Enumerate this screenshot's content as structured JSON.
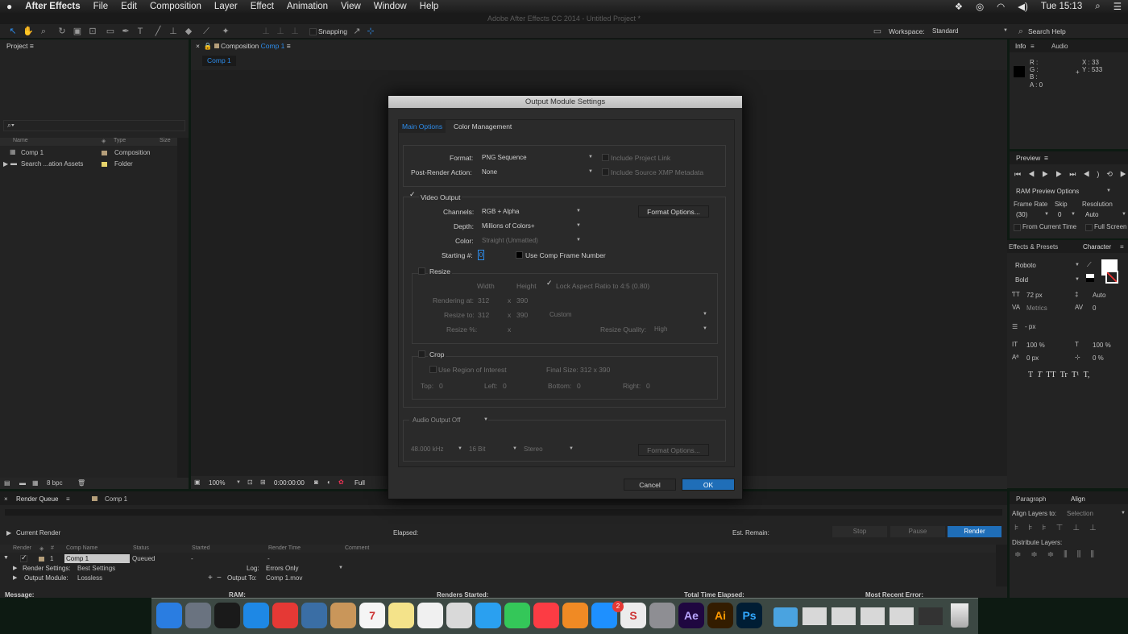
{
  "menubar": {
    "app": "After Effects",
    "items": [
      "File",
      "Edit",
      "Composition",
      "Layer",
      "Effect",
      "Animation",
      "View",
      "Window",
      "Help"
    ],
    "clock": "Tue 15:13"
  },
  "window_title": "Adobe After Effects CC 2014 - Untitled Project *",
  "toolbar": {
    "snapping": "Snapping",
    "workspace_label": "Workspace:",
    "workspace_value": "Standard",
    "search_placeholder": "Search Help"
  },
  "project": {
    "title": "Project",
    "search_icon": "search-icon",
    "columns": [
      "Name",
      "Type",
      "Size"
    ],
    "rows": [
      {
        "name": "Comp 1",
        "type": "Composition"
      },
      {
        "name": "Search ...ation Assets",
        "type": "Folder"
      }
    ],
    "bpc": "8 bpc"
  },
  "composition": {
    "tab_prefix": "Composition",
    "tab_name": "Comp 1",
    "subtab": "Comp 1",
    "zoom": "100%",
    "timecode": "0:00:00:00",
    "resolution": "Full"
  },
  "info": {
    "tabs": [
      "Info",
      "Audio"
    ],
    "r": "R :",
    "g": "G :",
    "b": "B :",
    "a": "A : 0",
    "x": "X : 33",
    "y": "Y : 533"
  },
  "preview": {
    "title": "Preview",
    "ram": "RAM Preview Options",
    "frame_rate_label": "Frame Rate",
    "skip_label": "Skip",
    "resolution_label": "Resolution",
    "frame_rate": "(30)",
    "skip": "0",
    "resolution": "Auto",
    "from_current": "From Current Time",
    "full_screen": "Full Screen"
  },
  "character": {
    "tabs": [
      "Effects & Presets",
      "Character"
    ],
    "font": "Roboto",
    "style": "Bold",
    "size": "72 px",
    "leading": "Auto",
    "kerning": "Metrics",
    "tracking": "0",
    "stroke": "- px",
    "vscale": "100 %",
    "hscale": "100 %",
    "baseline": "0 px",
    "tsume": "0 %",
    "styles": [
      "T",
      "T",
      "TT",
      "Tr",
      "T¹",
      "T,"
    ]
  },
  "align": {
    "tabs": [
      "Paragraph",
      "Align"
    ],
    "align_to": "Align Layers to:",
    "align_to_value": "Selection",
    "distribute": "Distribute Layers:"
  },
  "renderqueue": {
    "tab": "Render Queue",
    "comp_tab": "Comp 1",
    "current_render": "Current Render",
    "elapsed": "Elapsed:",
    "est_remain": "Est. Remain:",
    "stop": "Stop",
    "pause": "Pause",
    "render": "Render",
    "columns": [
      "Render",
      "#",
      "Comp Name",
      "Status",
      "Started",
      "Render Time",
      "Comment"
    ],
    "row": {
      "num": "1",
      "comp": "Comp 1",
      "status": "Queued",
      "started": "-",
      "time": "-"
    },
    "render_settings_label": "Render Settings:",
    "render_settings": "Best Settings",
    "log_label": "Log:",
    "log": "Errors Only",
    "output_module_label": "Output Module:",
    "output_module": "Lossless",
    "output_to_label": "Output To:",
    "output_to": "Comp 1.mov",
    "message": "Message:",
    "ram": "RAM:",
    "renders_started": "Renders Started:",
    "total_elapsed": "Total Time Elapsed:",
    "recent_error": "Most Recent Error:"
  },
  "dialog": {
    "title": "Output Module Settings",
    "tabs": [
      "Main Options",
      "Color Management"
    ],
    "format_label": "Format:",
    "format": "PNG Sequence",
    "include_project_link": "Include Project Link",
    "post_render_label": "Post-Render Action:",
    "post_render": "None",
    "include_xmp": "Include Source XMP Metadata",
    "video_output": "Video Output",
    "channels_label": "Channels:",
    "channels": "RGB + Alpha",
    "format_options": "Format Options...",
    "depth_label": "Depth:",
    "depth": "Millions of Colors+",
    "color_label": "Color:",
    "color": "Straight (Unmatted)",
    "starting_label": "Starting #:",
    "starting": "0",
    "use_comp_frame": "Use Comp Frame Number",
    "resize": "Resize",
    "width_hdr": "Width",
    "height_hdr": "Height",
    "lock_aspect": "Lock Aspect Ratio to 4:5 (0.80)",
    "rendering_at": "Rendering at:",
    "render_w": "312",
    "render_h": "390",
    "resize_to": "Resize to:",
    "resize_w": "312",
    "resize_h": "390",
    "resize_preset": "Custom",
    "resize_pct": "Resize %:",
    "x": "x",
    "resize_quality_label": "Resize Quality:",
    "resize_quality": "High",
    "crop": "Crop",
    "use_roi": "Use Region of Interest",
    "final_size": "Final Size: 312 x 390",
    "top": "Top:",
    "top_v": "0",
    "left": "Left:",
    "left_v": "0",
    "bottom": "Bottom:",
    "bottom_v": "0",
    "right": "Right:",
    "right_v": "0",
    "audio_output": "Audio Output Off",
    "audio_rate": "48.000 kHz",
    "audio_bits": "16 Bit",
    "audio_channels": "Stereo",
    "audio_format_options": "Format Options...",
    "cancel": "Cancel",
    "ok": "OK"
  },
  "dock": {
    "apps": [
      {
        "label": "",
        "color": "#2a7de1"
      },
      {
        "label": "",
        "color": "#6a7380"
      },
      {
        "label": "",
        "color": "#1a1a1a"
      },
      {
        "label": "",
        "color": "#1e88e5"
      },
      {
        "label": "",
        "color": "#e53935"
      },
      {
        "label": "",
        "color": "#3a6ea5"
      },
      {
        "label": "",
        "color": "#c9965a"
      },
      {
        "label": "7",
        "color": "#f5f5f5"
      },
      {
        "label": "",
        "color": "#f4e38a"
      },
      {
        "label": "",
        "color": "#f0f0f0"
      },
      {
        "label": "",
        "color": "#d9d9d9"
      },
      {
        "label": "",
        "color": "#2aa0f0"
      },
      {
        "label": "",
        "color": "#34c759"
      },
      {
        "label": "",
        "color": "#fc3c44"
      },
      {
        "label": "",
        "color": "#f08a24"
      },
      {
        "label": "",
        "color": "#1e90ff"
      },
      {
        "label": "S",
        "color": "#ececec"
      },
      {
        "label": "",
        "color": "#8e8e93"
      },
      {
        "label": "Ae",
        "color": "#1f0740"
      },
      {
        "label": "Ai",
        "color": "#331c00"
      },
      {
        "label": "Ps",
        "color": "#001d34"
      }
    ],
    "badge": "2"
  }
}
